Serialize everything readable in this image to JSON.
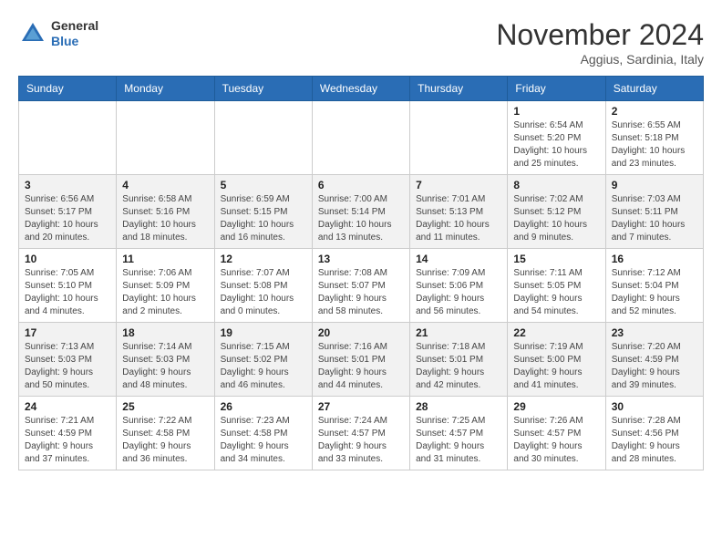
{
  "header": {
    "logo_general": "General",
    "logo_blue": "Blue",
    "month_year": "November 2024",
    "location": "Aggius, Sardinia, Italy"
  },
  "calendar": {
    "days_of_week": [
      "Sunday",
      "Monday",
      "Tuesday",
      "Wednesday",
      "Thursday",
      "Friday",
      "Saturday"
    ],
    "weeks": [
      [
        {
          "day": "",
          "info": ""
        },
        {
          "day": "",
          "info": ""
        },
        {
          "day": "",
          "info": ""
        },
        {
          "day": "",
          "info": ""
        },
        {
          "day": "",
          "info": ""
        },
        {
          "day": "1",
          "info": "Sunrise: 6:54 AM\nSunset: 5:20 PM\nDaylight: 10 hours and 25 minutes."
        },
        {
          "day": "2",
          "info": "Sunrise: 6:55 AM\nSunset: 5:18 PM\nDaylight: 10 hours and 23 minutes."
        }
      ],
      [
        {
          "day": "3",
          "info": "Sunrise: 6:56 AM\nSunset: 5:17 PM\nDaylight: 10 hours and 20 minutes."
        },
        {
          "day": "4",
          "info": "Sunrise: 6:58 AM\nSunset: 5:16 PM\nDaylight: 10 hours and 18 minutes."
        },
        {
          "day": "5",
          "info": "Sunrise: 6:59 AM\nSunset: 5:15 PM\nDaylight: 10 hours and 16 minutes."
        },
        {
          "day": "6",
          "info": "Sunrise: 7:00 AM\nSunset: 5:14 PM\nDaylight: 10 hours and 13 minutes."
        },
        {
          "day": "7",
          "info": "Sunrise: 7:01 AM\nSunset: 5:13 PM\nDaylight: 10 hours and 11 minutes."
        },
        {
          "day": "8",
          "info": "Sunrise: 7:02 AM\nSunset: 5:12 PM\nDaylight: 10 hours and 9 minutes."
        },
        {
          "day": "9",
          "info": "Sunrise: 7:03 AM\nSunset: 5:11 PM\nDaylight: 10 hours and 7 minutes."
        }
      ],
      [
        {
          "day": "10",
          "info": "Sunrise: 7:05 AM\nSunset: 5:10 PM\nDaylight: 10 hours and 4 minutes."
        },
        {
          "day": "11",
          "info": "Sunrise: 7:06 AM\nSunset: 5:09 PM\nDaylight: 10 hours and 2 minutes."
        },
        {
          "day": "12",
          "info": "Sunrise: 7:07 AM\nSunset: 5:08 PM\nDaylight: 10 hours and 0 minutes."
        },
        {
          "day": "13",
          "info": "Sunrise: 7:08 AM\nSunset: 5:07 PM\nDaylight: 9 hours and 58 minutes."
        },
        {
          "day": "14",
          "info": "Sunrise: 7:09 AM\nSunset: 5:06 PM\nDaylight: 9 hours and 56 minutes."
        },
        {
          "day": "15",
          "info": "Sunrise: 7:11 AM\nSunset: 5:05 PM\nDaylight: 9 hours and 54 minutes."
        },
        {
          "day": "16",
          "info": "Sunrise: 7:12 AM\nSunset: 5:04 PM\nDaylight: 9 hours and 52 minutes."
        }
      ],
      [
        {
          "day": "17",
          "info": "Sunrise: 7:13 AM\nSunset: 5:03 PM\nDaylight: 9 hours and 50 minutes."
        },
        {
          "day": "18",
          "info": "Sunrise: 7:14 AM\nSunset: 5:03 PM\nDaylight: 9 hours and 48 minutes."
        },
        {
          "day": "19",
          "info": "Sunrise: 7:15 AM\nSunset: 5:02 PM\nDaylight: 9 hours and 46 minutes."
        },
        {
          "day": "20",
          "info": "Sunrise: 7:16 AM\nSunset: 5:01 PM\nDaylight: 9 hours and 44 minutes."
        },
        {
          "day": "21",
          "info": "Sunrise: 7:18 AM\nSunset: 5:01 PM\nDaylight: 9 hours and 42 minutes."
        },
        {
          "day": "22",
          "info": "Sunrise: 7:19 AM\nSunset: 5:00 PM\nDaylight: 9 hours and 41 minutes."
        },
        {
          "day": "23",
          "info": "Sunrise: 7:20 AM\nSunset: 4:59 PM\nDaylight: 9 hours and 39 minutes."
        }
      ],
      [
        {
          "day": "24",
          "info": "Sunrise: 7:21 AM\nSunset: 4:59 PM\nDaylight: 9 hours and 37 minutes."
        },
        {
          "day": "25",
          "info": "Sunrise: 7:22 AM\nSunset: 4:58 PM\nDaylight: 9 hours and 36 minutes."
        },
        {
          "day": "26",
          "info": "Sunrise: 7:23 AM\nSunset: 4:58 PM\nDaylight: 9 hours and 34 minutes."
        },
        {
          "day": "27",
          "info": "Sunrise: 7:24 AM\nSunset: 4:57 PM\nDaylight: 9 hours and 33 minutes."
        },
        {
          "day": "28",
          "info": "Sunrise: 7:25 AM\nSunset: 4:57 PM\nDaylight: 9 hours and 31 minutes."
        },
        {
          "day": "29",
          "info": "Sunrise: 7:26 AM\nSunset: 4:57 PM\nDaylight: 9 hours and 30 minutes."
        },
        {
          "day": "30",
          "info": "Sunrise: 7:28 AM\nSunset: 4:56 PM\nDaylight: 9 hours and 28 minutes."
        }
      ]
    ]
  }
}
